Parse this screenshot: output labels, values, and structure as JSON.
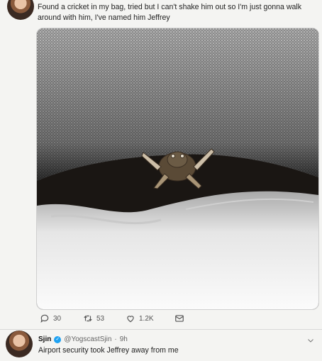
{
  "tweet": {
    "text": "Found a cricket in my bag, tried but I can't shake him out so I'm just gonna walk around with him, I've named him Jeffrey",
    "actions": {
      "replies": "30",
      "retweets": "53",
      "likes": "1.2K"
    }
  },
  "reply": {
    "name": "Sjin",
    "handle": "@YogscastSjin",
    "time": "9h",
    "text": "Airport security took Jeffrey away from me"
  },
  "colors": {
    "verified": "#1da1f2",
    "icon": "#555555"
  }
}
